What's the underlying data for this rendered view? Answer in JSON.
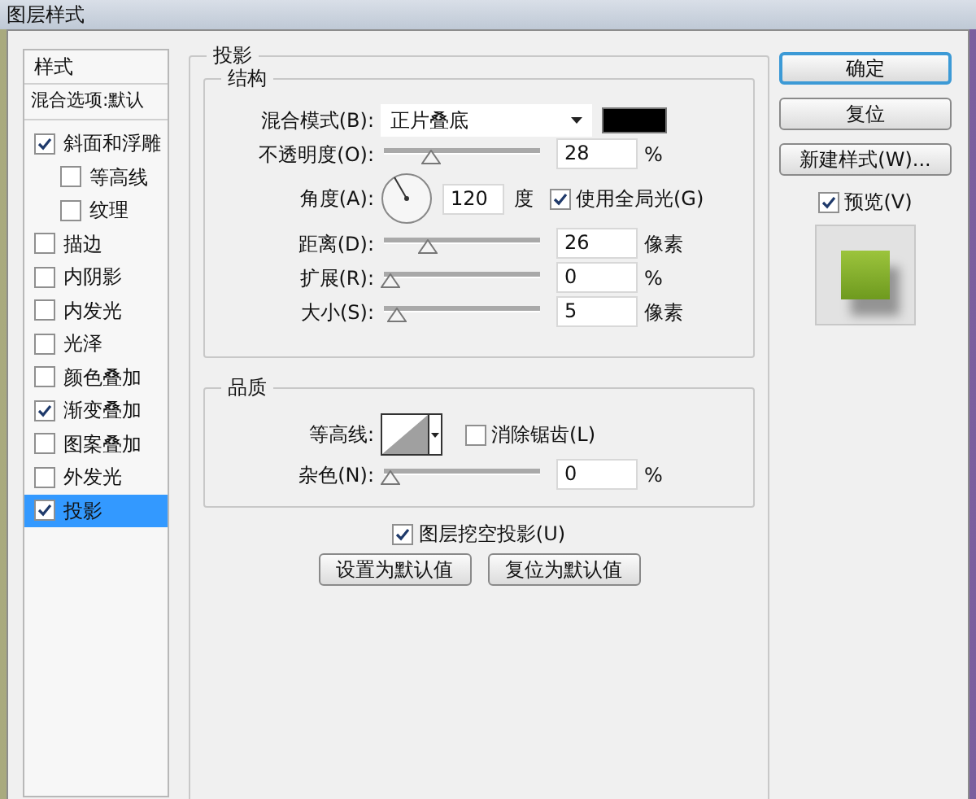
{
  "window": {
    "title": "图层样式"
  },
  "sidebar": {
    "header": "样式",
    "blending_options": "混合选项:默认",
    "items": [
      {
        "label": "斜面和浮雕",
        "checked": true,
        "selected": false,
        "children": [
          {
            "label": "等高线",
            "checked": false,
            "selected": false
          },
          {
            "label": "纹理",
            "checked": false,
            "selected": false
          }
        ]
      },
      {
        "label": "描边",
        "checked": false,
        "selected": false
      },
      {
        "label": "内阴影",
        "checked": false,
        "selected": false
      },
      {
        "label": "内发光",
        "checked": false,
        "selected": false
      },
      {
        "label": "光泽",
        "checked": false,
        "selected": false
      },
      {
        "label": "颜色叠加",
        "checked": false,
        "selected": false
      },
      {
        "label": "渐变叠加",
        "checked": true,
        "selected": false
      },
      {
        "label": "图案叠加",
        "checked": false,
        "selected": false
      },
      {
        "label": "外发光",
        "checked": false,
        "selected": false
      },
      {
        "label": "投影",
        "checked": true,
        "selected": true
      }
    ]
  },
  "panel": {
    "title": "投影",
    "structure": {
      "title": "结构",
      "blend_mode": {
        "label": "混合模式(B):",
        "value": "正片叠底"
      },
      "opacity": {
        "label": "不透明度(O):",
        "value": "28",
        "unit": "%",
        "level": 0.28
      },
      "angle": {
        "label": "角度(A):",
        "value": "120",
        "unit": "度",
        "global_light": {
          "label": "使用全局光(G)",
          "checked": true
        }
      },
      "sliders": [
        {
          "label": "距离(D):",
          "value": "26",
          "unit": "像素",
          "level": 0.26
        },
        {
          "label": "扩展(R):",
          "value": "0",
          "unit": "%",
          "level": 0
        },
        {
          "label": "大小(S):",
          "value": "5",
          "unit": "像素",
          "level": 0.05
        }
      ]
    },
    "quality": {
      "title": "品质",
      "contour_label": "等高线:",
      "anti_alias": {
        "label": "消除锯齿(L)",
        "checked": false
      },
      "noise": {
        "label": "杂色(N):",
        "value": "0",
        "unit": "%",
        "level": 0
      }
    },
    "knockout": {
      "label": "图层挖空投影(U)",
      "checked": true
    },
    "buttons": [
      "设置为默认值",
      "复位为默认值"
    ]
  },
  "actions": {
    "buttons": [
      {
        "label": "确定",
        "default": true
      },
      {
        "label": "复位",
        "default": false
      },
      {
        "label": "新建样式(W)...",
        "default": false
      }
    ],
    "preview": {
      "label": "预览(V)",
      "checked": true
    }
  }
}
